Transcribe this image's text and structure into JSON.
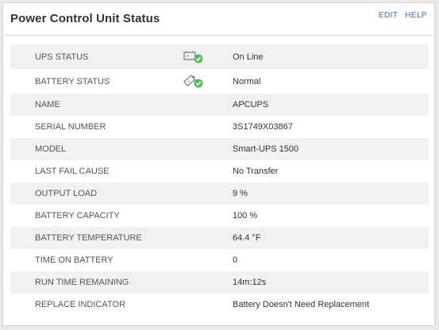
{
  "header": {
    "title": "Power Control Unit Status",
    "edit_label": "EDIT",
    "help_label": "HELP"
  },
  "rows": [
    {
      "label": "UPS STATUS",
      "value": "On Line",
      "icon": "ups-plug-ok-icon"
    },
    {
      "label": "BATTERY STATUS",
      "value": "Normal",
      "icon": "battery-ok-icon"
    },
    {
      "label": "NAME",
      "value": "APCUPS"
    },
    {
      "label": "SERIAL NUMBER",
      "value": "3S1749X03867"
    },
    {
      "label": "MODEL",
      "value": "Smart-UPS 1500"
    },
    {
      "label": "LAST FAIL CAUSE",
      "value": "No Transfer"
    },
    {
      "label": "OUTPUT LOAD",
      "value": "9 %"
    },
    {
      "label": "BATTERY CAPACITY",
      "value": "100 %"
    },
    {
      "label": "BATTERY TEMPERATURE",
      "value": "64.4 °F"
    },
    {
      "label": "TIME ON BATTERY",
      "value": "0"
    },
    {
      "label": "RUN TIME REMAINING",
      "value": "14m:12s"
    },
    {
      "label": "REPLACE INDICATOR",
      "value": "Battery Doesn't Need Replacement"
    }
  ],
  "colors": {
    "accent": "#3a6fb0",
    "ok_green": "#5cb85c",
    "row_shade": "#f1f1f1"
  }
}
